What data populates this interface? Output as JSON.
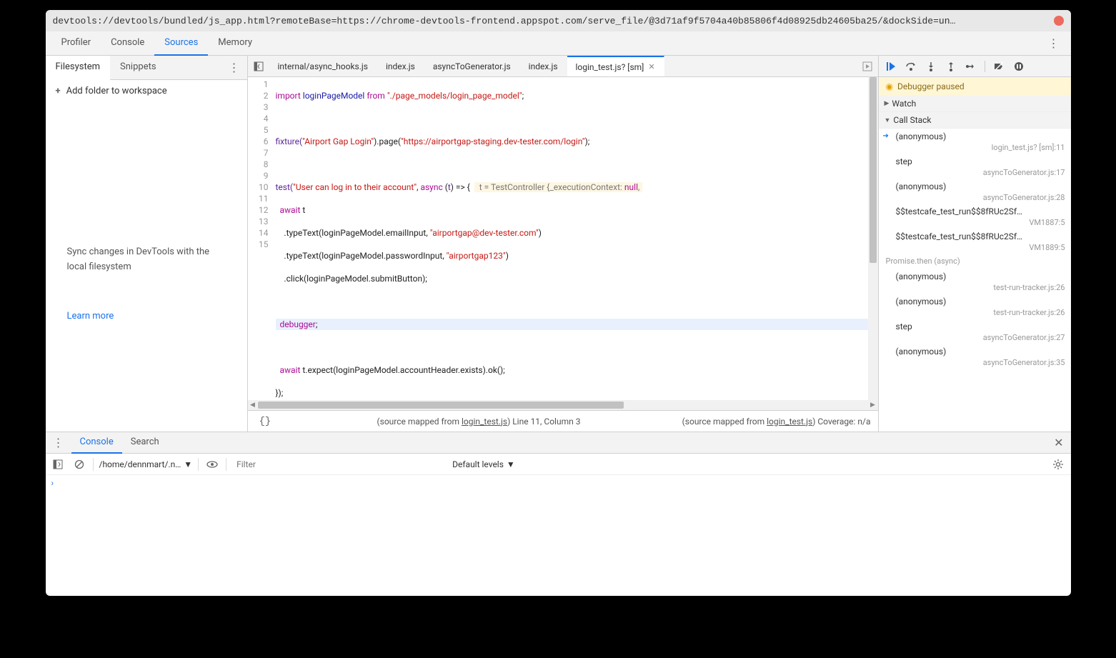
{
  "titlebar": "devtools://devtools/bundled/js_app.html?remoteBase=https://chrome-devtools-frontend.appspot.com/serve_file/@3d71af9f5704a40b85806f4d08925db24605ba25/&dockSide=un…",
  "mainTabs": {
    "profiler": "Profiler",
    "console": "Console",
    "sources": "Sources",
    "memory": "Memory"
  },
  "leftTabs": {
    "filesystem": "Filesystem",
    "snippets": "Snippets"
  },
  "addFolder": "Add folder to workspace",
  "syncMsg": "Sync changes in DevTools with the local filesystem",
  "learnMore": "Learn more",
  "fileTabs": {
    "t0": "internal/async_hooks.js",
    "t1": "index.js",
    "t2": "asyncToGenerator.js",
    "t3": "index.js",
    "t4": "login_test.js? [sm]"
  },
  "code": {
    "lines": 15,
    "l1a": "import",
    "l1b": " loginPageModel ",
    "l1c": "from",
    "l1d": " ",
    "l1e": "\"./page_models/login_page_model\"",
    "l1f": ";",
    "l3a": "fixture(",
    "l3b": "\"Airport Gap Login\"",
    "l3c": ").page(",
    "l3d": "\"https://airportgap-staging.dev-tester.com/login\"",
    "l3e": ");",
    "l5a": "test(",
    "l5b": "\"User can log in to their account\"",
    "l5c": ", ",
    "l5d": "async",
    "l5e": " (",
    "l5f": "t",
    "l5g": ") => {  ",
    "l5note_a": " t = TestController {",
    "l5note_b": "_executionContext: ",
    "l5note_c": "null",
    "l5note_d": ",",
    "l6a": "  ",
    "l6b": "await",
    "l6c": " t",
    "l7a": "    .typeText(loginPageModel.emailInput, ",
    "l7b": "\"airportgap@dev-tester.com\"",
    "l7c": ")",
    "l8a": "    .typeText(loginPageModel.passwordInput, ",
    "l8b": "\"airportgap123\"",
    "l8c": ")",
    "l9a": "    .click(loginPageModel.submitButton);",
    "l11a": "  ",
    "l11b": "debugger",
    "l11c": ";",
    "l13a": "  ",
    "l13b": "await",
    "l13c": " t.expect(loginPageModel.accountHeader.exists).ok();",
    "l14a": "});"
  },
  "status": {
    "left": "(source mapped from ",
    "leftLink": "login_test.js",
    "leftEnd": ") Line 11, Column 3",
    "right": "(source mapped from ",
    "rightLink": "login_test.js",
    "rightEnd": ") Coverage: n/a"
  },
  "debugPaused": "Debugger paused",
  "sections": {
    "watch": "Watch",
    "callStack": "Call Stack"
  },
  "stack": {
    "f0n": "(anonymous)",
    "f0l": "login_test.js? [sm]:11",
    "f1n": "step",
    "f1l": "asyncToGenerator.js:17",
    "f2n": "(anonymous)",
    "f2l": "asyncToGenerator.js:28",
    "f3n": "$$testcafe_test_run$$8fRUc2Sf…",
    "f3l": "VM1887:5",
    "f4n": "$$testcafe_test_run$$8fRUc2Sf…",
    "f4l": "VM1889:5",
    "asyncLabel": "Promise.then (async)",
    "f5n": "(anonymous)",
    "f5l": "test-run-tracker.js:26",
    "f6n": "(anonymous)",
    "f6l": "test-run-tracker.js:26",
    "f7n": "step",
    "f7l": "asyncToGenerator.js:27",
    "f8n": "(anonymous)",
    "f8l": "asyncToGenerator.js:35"
  },
  "drawer": {
    "console": "Console",
    "search": "Search"
  },
  "consoleToolbar": {
    "context": "/home/dennmart/.n…",
    "filterPlaceholder": "Filter",
    "levels": "Default levels"
  },
  "consolePrompt": "›"
}
